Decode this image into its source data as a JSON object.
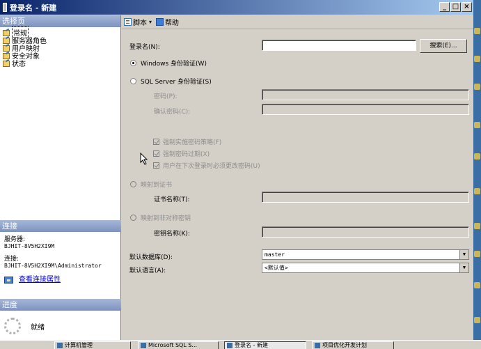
{
  "window": {
    "title": "登录名 - 新建"
  },
  "left": {
    "select_page_header": "选择页",
    "pages": [
      {
        "label": "常规",
        "selected": true
      },
      {
        "label": "服务器角色",
        "selected": false
      },
      {
        "label": "用户映射",
        "selected": false
      },
      {
        "label": "安全对象",
        "selected": false
      },
      {
        "label": "状态",
        "selected": false
      }
    ],
    "connection_header": "连接",
    "server_label": "服务器:",
    "server_value": "BJHIT-8V5H2XI9M",
    "connection_label": "连接:",
    "connection_value": "BJHIT-8V5H2XI9M\\Administrator",
    "view_properties_link": "查看连接属性",
    "progress_header": "进度",
    "progress_status": "就绪"
  },
  "toolbar": {
    "script": "脚本",
    "script_arrow": "▾",
    "help": "帮助"
  },
  "form": {
    "login_name_label": "登录名(N):",
    "login_name_value": "",
    "search_button": "搜索(E)...",
    "windows_auth": "Windows 身份验证(W)",
    "sql_auth": "SQL Server 身份验证(S)",
    "password_label": "密码(P):",
    "confirm_password_label": "确认密码(C):",
    "enforce_policy": "强制实施密码策略(F)",
    "enforce_expiration": "强制密码过期(X)",
    "must_change": "用户在下次登录时必须更改密码(U)",
    "map_certificate": "映射到证书",
    "certificate_name_label": "证书名称(T):",
    "map_asym_key": "映射到非对称密钥",
    "key_name_label": "密钥名称(K):",
    "default_db_label": "默认数据库(D):",
    "default_db_value": "master",
    "default_lang_label": "默认语言(A):",
    "default_lang_value": "<默认值>"
  },
  "taskbar": {
    "items": [
      "计算机管理",
      "Microsoft SQL S...",
      "登录名 - 新建",
      "项目优化开发计划"
    ],
    "active_index": 2
  }
}
